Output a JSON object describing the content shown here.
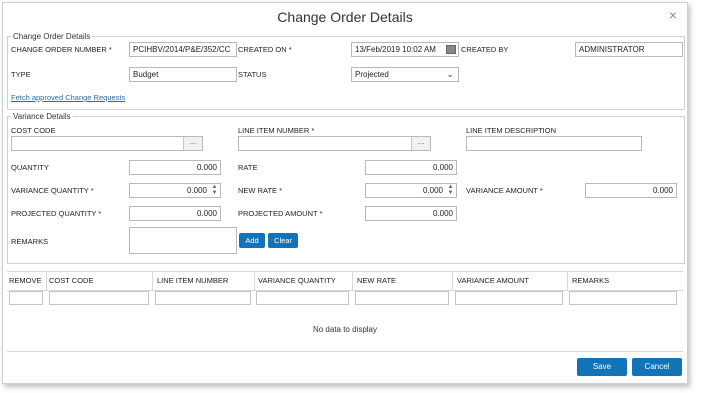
{
  "dialog": {
    "title": "Change Order Details",
    "close_glyph": "×"
  },
  "change_order": {
    "legend": "Change Order Details",
    "number_label": "CHANGE ORDER NUMBER *",
    "number_value": "PCIHBV/2014/P&E/352/CC",
    "created_on_label": "CREATED ON *",
    "created_on_value": "13/Feb/2019 10:02 AM",
    "created_by_label": "CREATED BY",
    "created_by_value": "ADMINISTRATOR",
    "type_label": "TYPE",
    "type_value": "Budget",
    "status_label": "STATUS",
    "status_value": "Projected",
    "fetch_link": "Fetch approved Change Requests"
  },
  "variance": {
    "legend": "Variance Details",
    "cost_code_label": "COST CODE",
    "line_item_number_label": "LINE ITEM NUMBER *",
    "line_item_description_label": "LINE ITEM DESCRIPTION",
    "quantity_label": "QUANTITY",
    "quantity_value": "0.000",
    "rate_label": "RATE",
    "rate_value": "0.000",
    "variance_quantity_label": "VARIANCE QUANTITY *",
    "variance_quantity_value": "0.000",
    "new_rate_label": "NEW RATE *",
    "new_rate_value": "0.000",
    "variance_amount_label": "VARIANCE AMOUNT *",
    "variance_amount_value": "0.000",
    "projected_quantity_label": "PROJECTED QUANTITY *",
    "projected_quantity_value": "0.000",
    "projected_amount_label": "PROJECTED AMOUNT *",
    "projected_amount_value": "0.000",
    "remarks_label": "REMARKS",
    "add_label": "Add",
    "clear_label": "Clear",
    "lookup_glyph": "...",
    "spin_up": "▲",
    "spin_down": "▼",
    "select_glyph": "⌄"
  },
  "grid": {
    "columns": [
      "REMOVE",
      "COST CODE",
      "LINE ITEM NUMBER",
      "VARIANCE QUANTITY",
      "NEW RATE",
      "VARIANCE AMOUNT",
      "REMARKS"
    ],
    "empty_text": "No data to display"
  },
  "footer": {
    "save_label": "Save",
    "cancel_label": "Cancel"
  },
  "colors": {
    "accent": "#1273b8",
    "link": "#1f6fb0",
    "border": "#b9b9b9"
  }
}
